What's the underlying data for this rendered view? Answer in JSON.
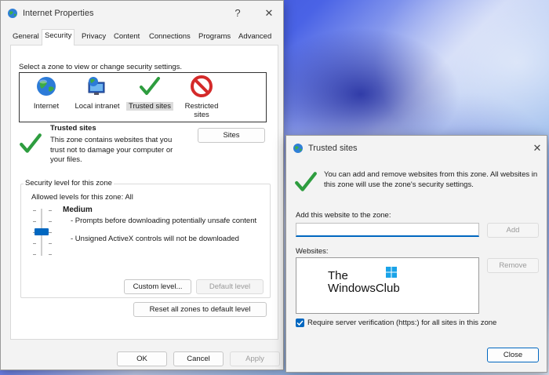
{
  "internet_properties": {
    "title": "Internet Properties",
    "help": "?",
    "close": "✕",
    "tabs": [
      "General",
      "Security",
      "Privacy",
      "Content",
      "Connections",
      "Programs",
      "Advanced"
    ],
    "zone_prompt": "Select a zone to view or change security settings.",
    "zones": [
      {
        "label": "Internet"
      },
      {
        "label": "Local intranet"
      },
      {
        "label": "Trusted sites"
      },
      {
        "label": "Restricted sites"
      }
    ],
    "zone_info": {
      "heading": "Trusted sites",
      "description": "This zone contains websites that you trust not to damage your computer or your files.",
      "sites_button": "Sites"
    },
    "security_level": {
      "legend": "Security level for this zone",
      "allowed": "Allowed levels for this zone: All",
      "level": "Medium",
      "bullets": [
        "- Prompts before downloading potentially unsafe content",
        "- Unsigned ActiveX controls will not be downloaded"
      ],
      "custom_button": "Custom level...",
      "default_button": "Default level",
      "level_fraction": 0.5
    },
    "reset_button": "Reset all zones to default level",
    "ok_button": "OK",
    "cancel_button": "Cancel",
    "apply_button": "Apply"
  },
  "trusted_sites": {
    "title": "Trusted sites",
    "close": "✕",
    "info": "You can add and remove websites from this zone. All websites in this zone will use the zone's security settings.",
    "add_label": "Add this website to the zone:",
    "add_value": "",
    "add_button": "Add",
    "websites_label": "Websites:",
    "watermark_line1": "The",
    "watermark_line2": "WindowsClub",
    "remove_button": "Remove",
    "verify_label": "Require server verification (https:) for all sites in this zone",
    "verify_checked": true,
    "close_button": "Close"
  },
  "colors": {
    "accent": "#0067c0",
    "check_green": "#2e9d3f",
    "restricted_red": "#d42a2a"
  }
}
